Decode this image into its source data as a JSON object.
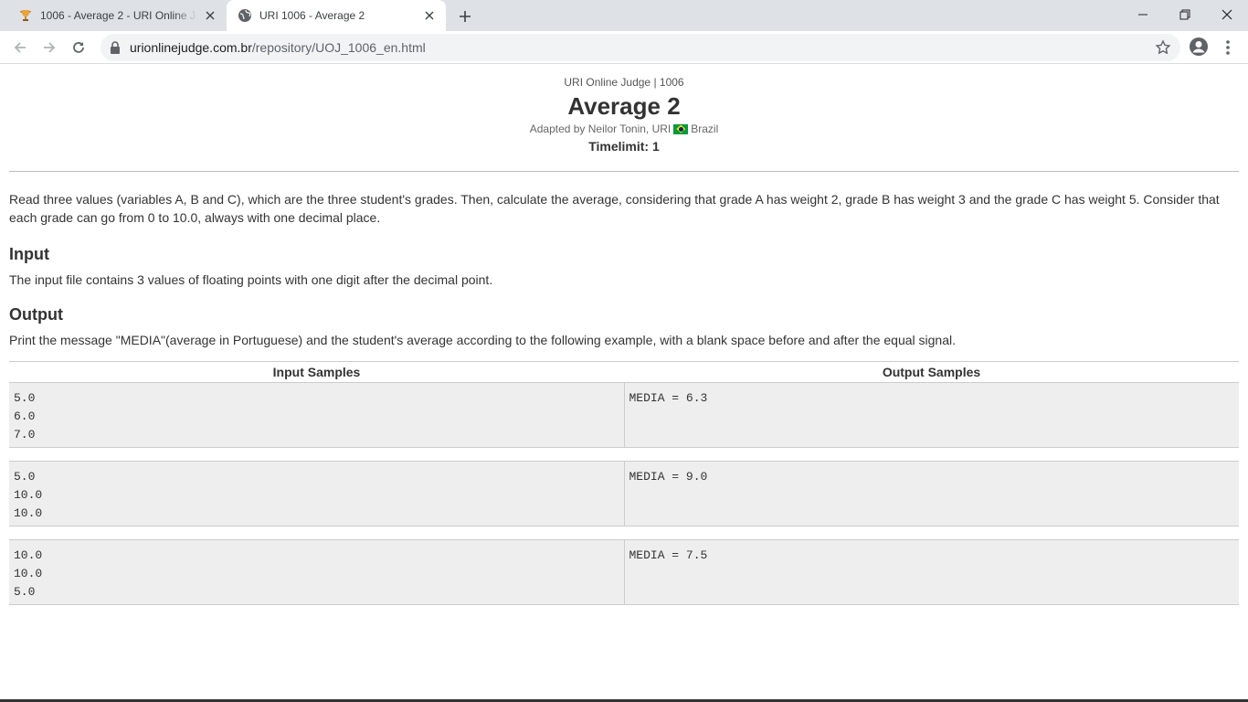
{
  "browser": {
    "tabs": [
      {
        "title": "1006 - Average 2 - URI Online Judge",
        "icon": "trophy-icon",
        "active": false
      },
      {
        "title": "URI 1006 - Average 2",
        "icon": "globe-icon",
        "active": true
      }
    ],
    "url_host": "urionlinejudge.com.br",
    "url_path": "/repository/UOJ_1006_en.html"
  },
  "problem": {
    "judge_line": "URI Online Judge | 1006",
    "title": "Average 2",
    "adapted_by": "Adapted by Neilor Tonin, URI",
    "country": "Brazil",
    "timelimit": "Timelimit: 1",
    "description": "Read three values (variables A, B and C), which are the three student's grades. Then, calculate the average, considering that grade A has weight 2, grade B has weight 3 and the grade C has weight 5. Consider that each grade can go from 0 to 10.0, always with one decimal place.",
    "input_heading": "Input",
    "input_text": "The input file contains 3 values of floating points with one digit after the decimal point.",
    "output_heading": "Output",
    "output_text": "Print the message \"MEDIA\"(average in Portuguese) and the student's average according to the following example, with a blank space before and after the equal signal."
  },
  "samples": {
    "input_header": "Input Samples",
    "output_header": "Output Samples",
    "rows": [
      {
        "input": [
          "5.0",
          "6.0",
          "7.0"
        ],
        "output": [
          "MEDIA = 6.3"
        ]
      },
      {
        "input": [
          "5.0",
          "10.0",
          "10.0"
        ],
        "output": [
          "MEDIA = 9.0"
        ]
      },
      {
        "input": [
          "10.0",
          "10.0",
          "5.0"
        ],
        "output": [
          "MEDIA = 7.5"
        ]
      }
    ]
  }
}
